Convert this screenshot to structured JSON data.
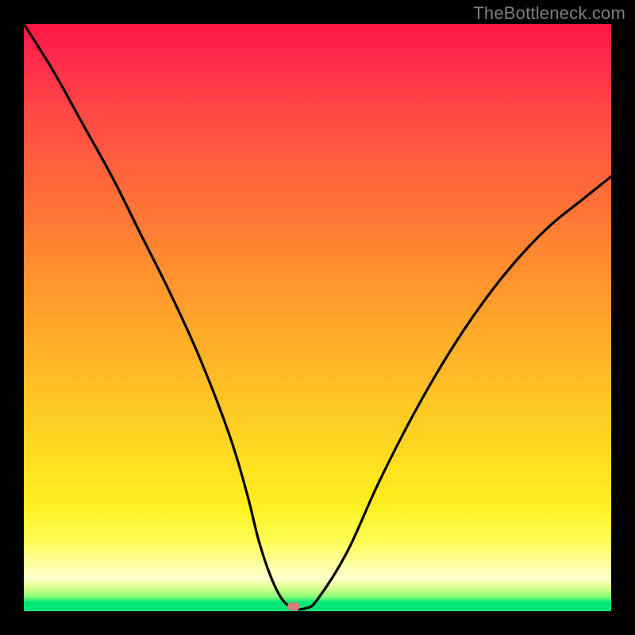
{
  "watermark": "TheBottleneck.com",
  "chart_data": {
    "type": "line",
    "title": "",
    "xlabel": "",
    "ylabel": "",
    "xlim": [
      0,
      100
    ],
    "ylim": [
      0,
      100
    ],
    "grid": false,
    "legend": false,
    "background_gradient": {
      "direction": "vertical",
      "stops": [
        {
          "pos": 0,
          "color": "#ff1744"
        },
        {
          "pos": 0.28,
          "color": "#ff6a3a"
        },
        {
          "pos": 0.55,
          "color": "#ffb028"
        },
        {
          "pos": 0.82,
          "color": "#fff01f"
        },
        {
          "pos": 0.96,
          "color": "#d9ff8a"
        },
        {
          "pos": 1.0,
          "color": "#00e676"
        }
      ]
    },
    "series": [
      {
        "name": "bottleneck-curve",
        "color": "#000000",
        "x": [
          0,
          5,
          10,
          15,
          20,
          25,
          30,
          35,
          38,
          40,
          42,
          44,
          46,
          48,
          50,
          55,
          60,
          65,
          70,
          75,
          80,
          85,
          90,
          95,
          100
        ],
        "y": [
          100,
          92,
          83,
          74,
          64,
          54,
          43,
          30,
          20,
          12,
          6,
          2,
          0.5,
          0.5,
          2,
          10,
          21,
          31,
          40,
          48,
          55,
          61,
          66,
          70,
          74
        ]
      }
    ],
    "marker": {
      "x": 46,
      "y": 0.8,
      "color": "#d97a7a",
      "shape": "pill"
    }
  }
}
